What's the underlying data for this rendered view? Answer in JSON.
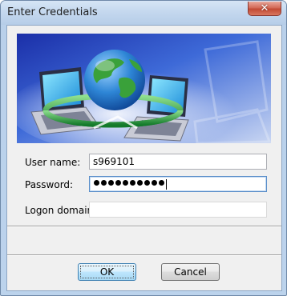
{
  "window": {
    "title": "Enter Credentials",
    "close_glyph": "✕"
  },
  "banner": {
    "description_icon": "network-globe-laptops-illustration",
    "colors": {
      "sky": "#2a4fc4",
      "globe_land": "#3aa13a",
      "globe_ocean": "#2e86d6",
      "ring": "#1e9c3a"
    }
  },
  "form": {
    "username_label": "User name:",
    "username_value": "s969101",
    "password_label": "Password:",
    "password_dots": 10,
    "domain_label": "Logon domain:",
    "domain_value": ""
  },
  "buttons": {
    "ok_label": "OK",
    "cancel_label": "Cancel"
  }
}
